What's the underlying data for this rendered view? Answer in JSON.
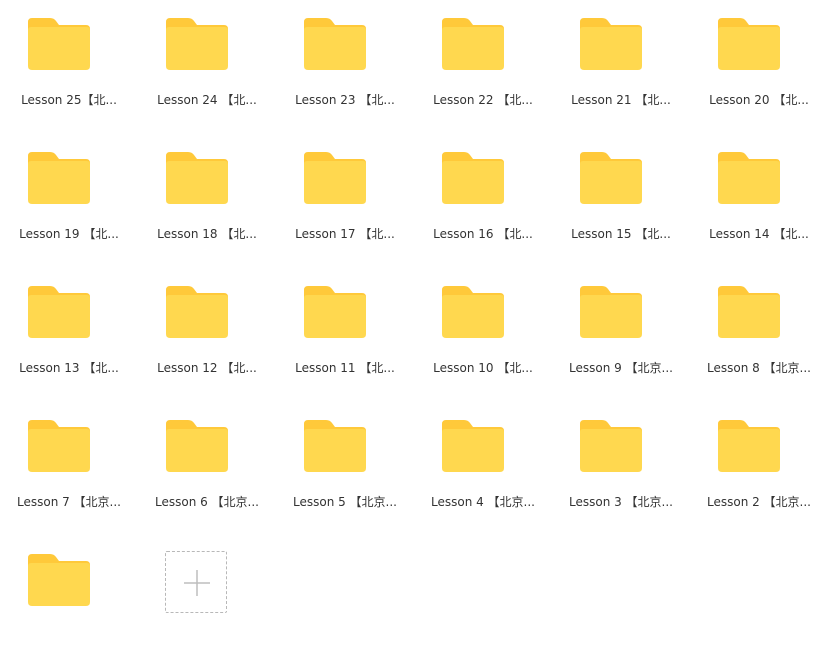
{
  "folders": [
    {
      "label": "Lesson 25【北..."
    },
    {
      "label": "Lesson 24 【北..."
    },
    {
      "label": "Lesson 23 【北..."
    },
    {
      "label": "Lesson 22 【北..."
    },
    {
      "label": "Lesson 21 【北..."
    },
    {
      "label": "Lesson 20 【北..."
    },
    {
      "label": "Lesson 19 【北..."
    },
    {
      "label": "Lesson 18 【北..."
    },
    {
      "label": "Lesson 17 【北..."
    },
    {
      "label": "Lesson 16 【北..."
    },
    {
      "label": "Lesson 15 【北..."
    },
    {
      "label": "Lesson 14 【北..."
    },
    {
      "label": "Lesson 13 【北..."
    },
    {
      "label": "Lesson 12 【北..."
    },
    {
      "label": "Lesson 11 【北..."
    },
    {
      "label": "Lesson 10 【北..."
    },
    {
      "label": "Lesson 9 【北京..."
    },
    {
      "label": "Lesson 8 【北京..."
    },
    {
      "label": "Lesson 7 【北京..."
    },
    {
      "label": "Lesson 6 【北京..."
    },
    {
      "label": "Lesson 5 【北京..."
    },
    {
      "label": "Lesson 4 【北京..."
    },
    {
      "label": "Lesson 3 【北京..."
    },
    {
      "label": "Lesson 2 【北京..."
    },
    {
      "label": ""
    }
  ],
  "add_tile": {
    "icon": "plus-icon"
  },
  "colors": {
    "folder_back": "#FFC93A",
    "folder_front": "#FFD84F",
    "label_text": "#333333",
    "add_border": "#B8B8B8",
    "plus": "#BDBDBD"
  }
}
